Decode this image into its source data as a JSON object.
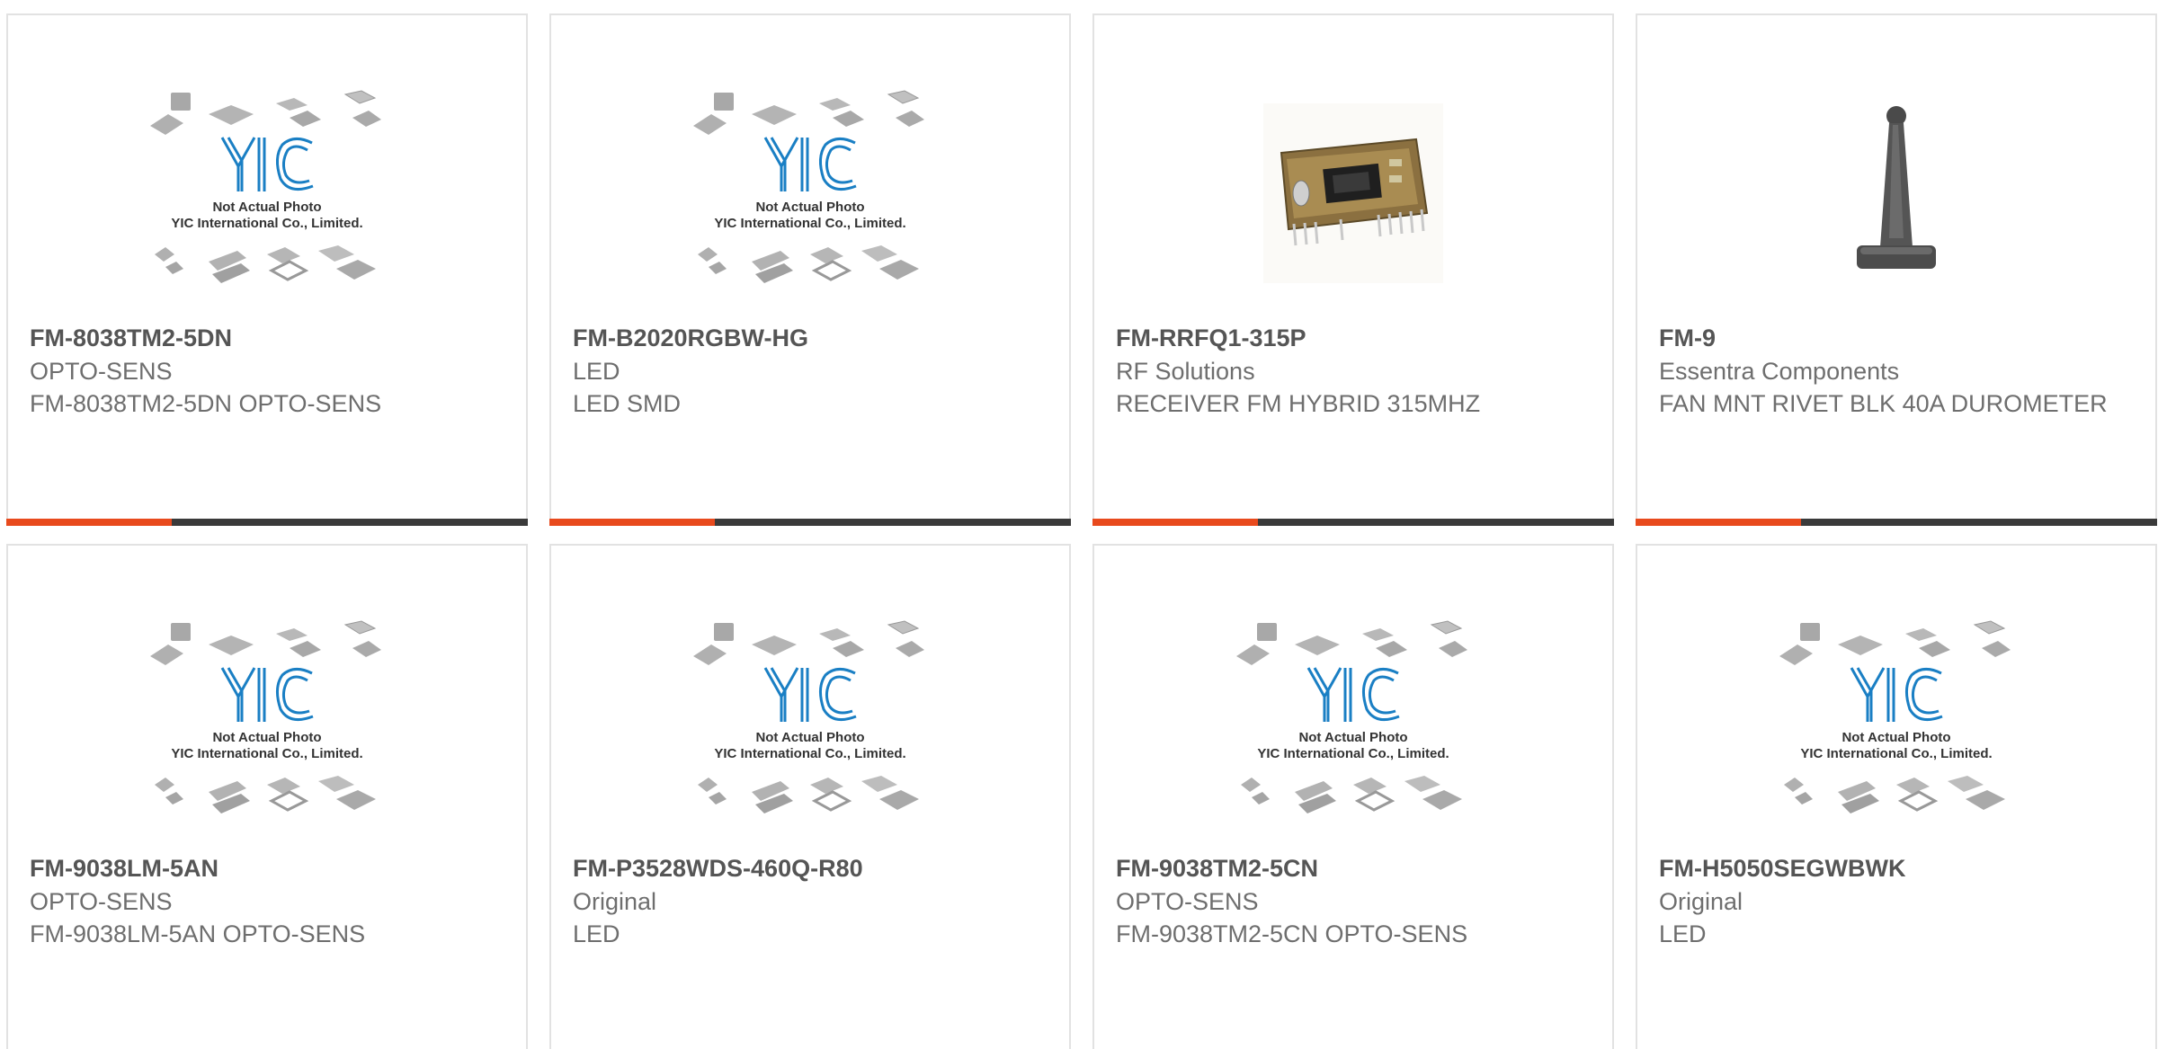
{
  "products": [
    {
      "part_number": "FM-8038TM2-5DN",
      "manufacturer": "OPTO-SENS",
      "description": "FM-8038TM2-5DN OPTO-SENS",
      "image": "placeholder",
      "placeholder_text_1": "Not Actual Photo",
      "placeholder_text_2": "YIC International Co., Limited."
    },
    {
      "part_number": "FM-B2020RGBW-HG",
      "manufacturer": "LED",
      "description": "LED SMD",
      "image": "placeholder",
      "placeholder_text_1": "Not Actual Photo",
      "placeholder_text_2": "YIC International Co., Limited."
    },
    {
      "part_number": "FM-RRFQ1-315P",
      "manufacturer": "RF Solutions",
      "description": "RECEIVER FM HYBRID 315MHZ",
      "image": "rf-module-photo"
    },
    {
      "part_number": "FM-9",
      "manufacturer": "Essentra Components",
      "description": "FAN MNT RIVET BLK 40A DUROMETER",
      "image": "fan-rivet-photo"
    },
    {
      "part_number": "FM-9038LM-5AN",
      "manufacturer": "OPTO-SENS",
      "description": "FM-9038LM-5AN OPTO-SENS",
      "image": "placeholder",
      "placeholder_text_1": "Not Actual Photo",
      "placeholder_text_2": "YIC International Co., Limited."
    },
    {
      "part_number": "FM-P3528WDS-460Q-R80",
      "manufacturer": "Original",
      "description": "LED",
      "image": "placeholder",
      "placeholder_text_1": "Not Actual Photo",
      "placeholder_text_2": "YIC International Co., Limited."
    },
    {
      "part_number": "FM-9038TM2-5CN",
      "manufacturer": "OPTO-SENS",
      "description": "FM-9038TM2-5CN OPTO-SENS",
      "image": "placeholder",
      "placeholder_text_1": "Not Actual Photo",
      "placeholder_text_2": "YIC International Co., Limited."
    },
    {
      "part_number": "FM-H5050SEGWBWK",
      "manufacturer": "Original",
      "description": "LED",
      "image": "placeholder",
      "placeholder_text_1": "Not Actual Photo",
      "placeholder_text_2": "YIC International Co., Limited."
    }
  ],
  "colors": {
    "accent": "#e84a1d",
    "bar": "#3a3a3a",
    "logo_blue": "#1a7fc4",
    "border": "#e2e2e2"
  }
}
